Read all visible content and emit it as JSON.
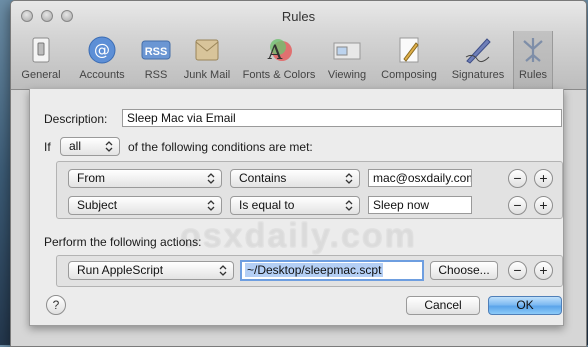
{
  "window": {
    "title": "Rules"
  },
  "toolbar": {
    "items": [
      {
        "label": "General",
        "icon": "switch-icon"
      },
      {
        "label": "Accounts",
        "icon": "at-sign-icon"
      },
      {
        "label": "RSS",
        "icon": "rss-icon"
      },
      {
        "label": "Junk Mail",
        "icon": "junk-mail-icon"
      },
      {
        "label": "Fonts & Colors",
        "icon": "fonts-colors-icon"
      },
      {
        "label": "Viewing",
        "icon": "viewing-icon"
      },
      {
        "label": "Composing",
        "icon": "pencil-icon"
      },
      {
        "label": "Signatures",
        "icon": "pen-icon"
      },
      {
        "label": "Rules",
        "icon": "rules-icon"
      }
    ],
    "active": "Rules"
  },
  "sheet": {
    "description_label": "Description:",
    "description_value": "Sleep Mac via Email",
    "if_label": "If",
    "match_select": "all",
    "conditions_suffix": "of the following conditions are met:",
    "conditions": [
      {
        "field": "From",
        "operator": "Contains",
        "value": "mac@osxdaily.com"
      },
      {
        "field": "Subject",
        "operator": "Is equal to",
        "value": "Sleep now"
      }
    ],
    "actions_label": "Perform the following actions:",
    "action": {
      "type": "Run AppleScript",
      "path": "~/Desktop/sleepmac.scpt",
      "choose_label": "Choose..."
    },
    "minus": "−",
    "plus": "+",
    "help": "?",
    "cancel_label": "Cancel",
    "ok_label": "OK",
    "watermark": "osxdaily.com"
  },
  "colors": {
    "default_button": "#5ba4ea",
    "focus_ring": "#6e9ee0"
  }
}
